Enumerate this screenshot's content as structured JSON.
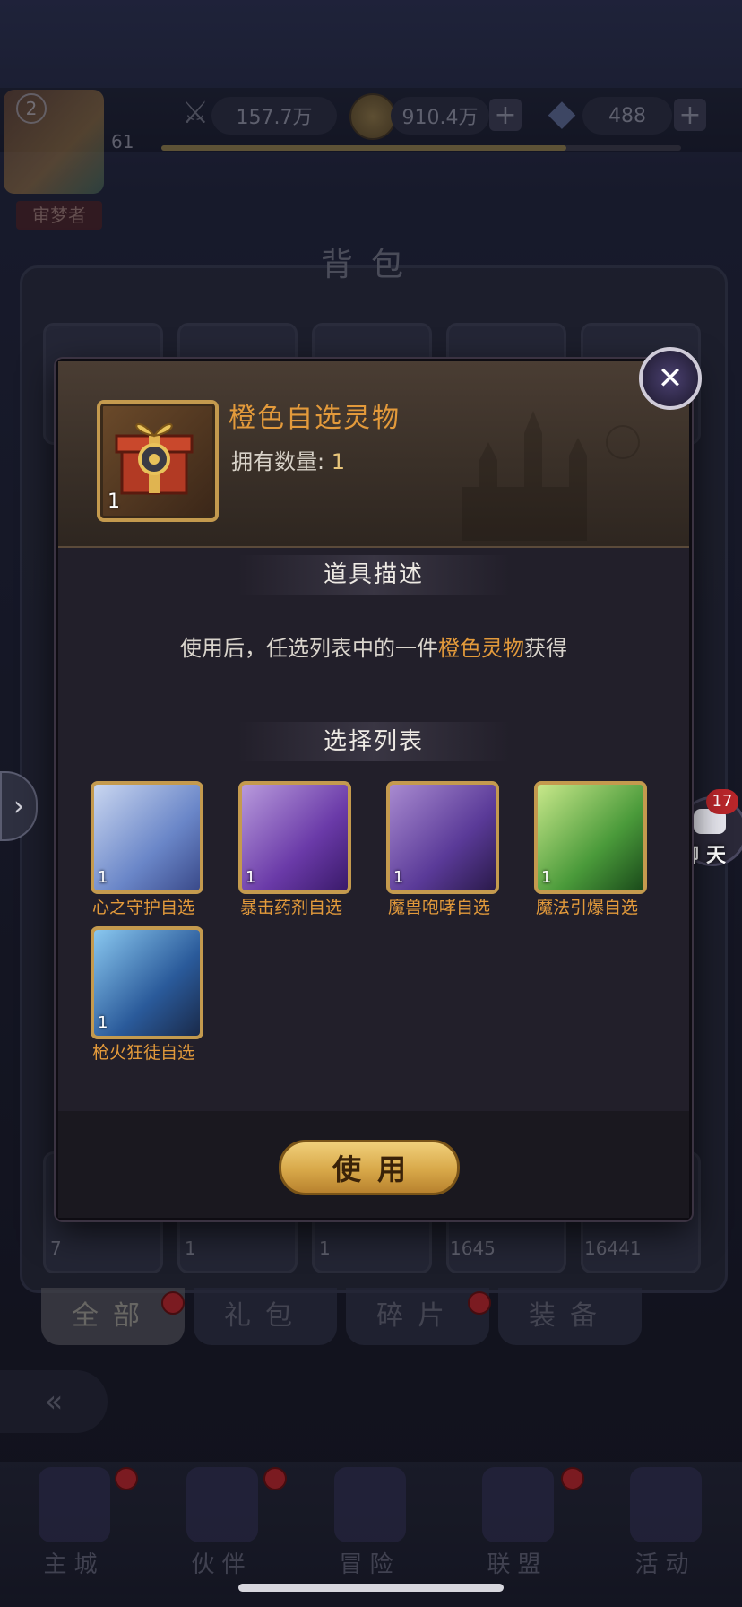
{
  "hud": {
    "player_level": "2",
    "player_level_small": "61",
    "player_title": "审梦者",
    "power_value": "157.7万",
    "gold_value": "910.4万",
    "gem_value": "488",
    "plus_label": "+"
  },
  "backpack": {
    "title": "背包",
    "slot_counts": [
      "7",
      "1",
      "1",
      "1645",
      "16441"
    ],
    "tabs": [
      "全部",
      "礼包",
      "碎片",
      "装备"
    ]
  },
  "modal": {
    "item_name": "橙色自选灵物",
    "item_count": "1",
    "own_label": "拥有数量:",
    "own_value": "1",
    "close_label": "✕",
    "desc_section_title": "道具描述",
    "desc_prefix": "使用后，任选列表中的一件",
    "desc_highlight": "橙色灵物",
    "desc_suffix": "获得",
    "choice_section_title": "选择列表",
    "choices": [
      {
        "label": "心之守护自选",
        "count": "1"
      },
      {
        "label": "暴击药剂自选",
        "count": "1"
      },
      {
        "label": "魔兽咆哮自选",
        "count": "1"
      },
      {
        "label": "魔法引爆自选",
        "count": "1"
      },
      {
        "label": "枪火狂徒自选",
        "count": "1"
      }
    ],
    "use_button": "使用"
  },
  "chat": {
    "badge": "17",
    "label": "聊天"
  },
  "nav": {
    "items": [
      "主城",
      "伙伴",
      "冒险",
      "联盟",
      "活动"
    ]
  },
  "colors": {
    "accent_orange": "#e39a3b",
    "gold_border": "#c49a4e",
    "button_gold": "#d8a849",
    "badge_red": "#b8262a"
  }
}
